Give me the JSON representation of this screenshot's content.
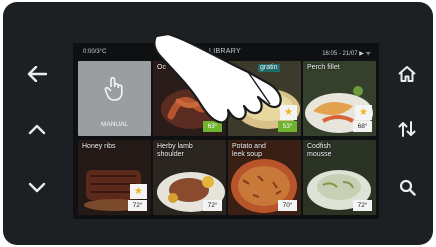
{
  "sidebar_left": {
    "back_icon": "arrow-left",
    "up_icon": "chevron-up",
    "down_icon": "chevron-down"
  },
  "sidebar_right": {
    "home_icon": "home",
    "sort_icon": "sort-arrows",
    "search_icon": "search"
  },
  "status_bar": {
    "left": "0:00/3°C",
    "center": "LIBRARY",
    "right": "16:05 - 21/07  ▶ ᯤ"
  },
  "tiles": [
    {
      "id": "manual",
      "label": "MANUAL"
    },
    {
      "id": "octopus",
      "label": "Oc",
      "temp": "63°"
    },
    {
      "id": "gratin",
      "label": "gratin",
      "temp": "53°",
      "favorite": true
    },
    {
      "id": "perch-fillet",
      "label": "Perch fillet",
      "temp": "68°",
      "favorite": true
    },
    {
      "id": "honey-ribs",
      "label": "Honey ribs",
      "temp": "72°",
      "favorite": true
    },
    {
      "id": "herby-lamb-shoulder",
      "label": "Herby lamb\nshoulder",
      "temp": "72°"
    },
    {
      "id": "potato-leek-soup",
      "label": "Potato and\nleek soup",
      "temp": "70°"
    },
    {
      "id": "codfish-mousse",
      "label": "Codfish\nmousse",
      "temp": "72°"
    }
  ],
  "colors": {
    "device": "#1c2023",
    "manual_tile": "#9a9ea1",
    "star": "#f1b51c",
    "green_temp": "#6fb32f"
  }
}
